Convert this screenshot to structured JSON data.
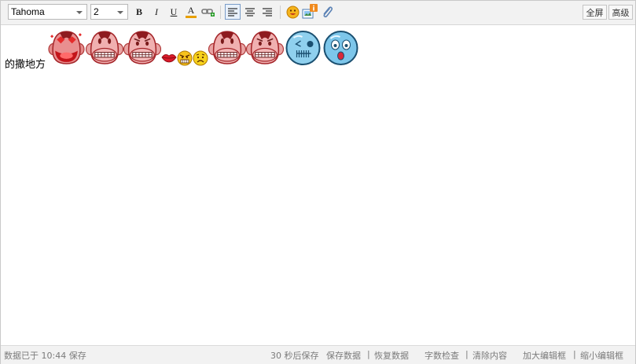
{
  "toolbar": {
    "font_family": "Tahoma",
    "font_size": "2",
    "bold_label": "B",
    "italic_label": "I",
    "underline_label": "U",
    "font_color_label": "A",
    "font_color_accent": "#e8a000",
    "fullscreen_label": "全屏",
    "advanced_label": "高级"
  },
  "content": {
    "text": "的撒地方",
    "emoticons": [
      "monkey-love-icon",
      "monkey-grin-icon",
      "monkey-angry-icon",
      "lips-icon",
      "smiley-angry-icon",
      "smiley-sad-icon",
      "monkey-grin-icon",
      "monkey-angry-icon",
      "skull-icon",
      "surprised-face-icon"
    ]
  },
  "status": {
    "saved_prefix": "数据已于",
    "saved_time": "10:44",
    "saved_suffix": "保存",
    "countdown_num": "30",
    "countdown_text": "秒后保存",
    "save_data": "保存数据",
    "restore_data": "恢复数据",
    "word_check": "字数检查",
    "clear_content": "清除内容",
    "enlarge_editor": "加大编辑框",
    "shrink_editor": "缩小编辑框",
    "separator": "|"
  }
}
